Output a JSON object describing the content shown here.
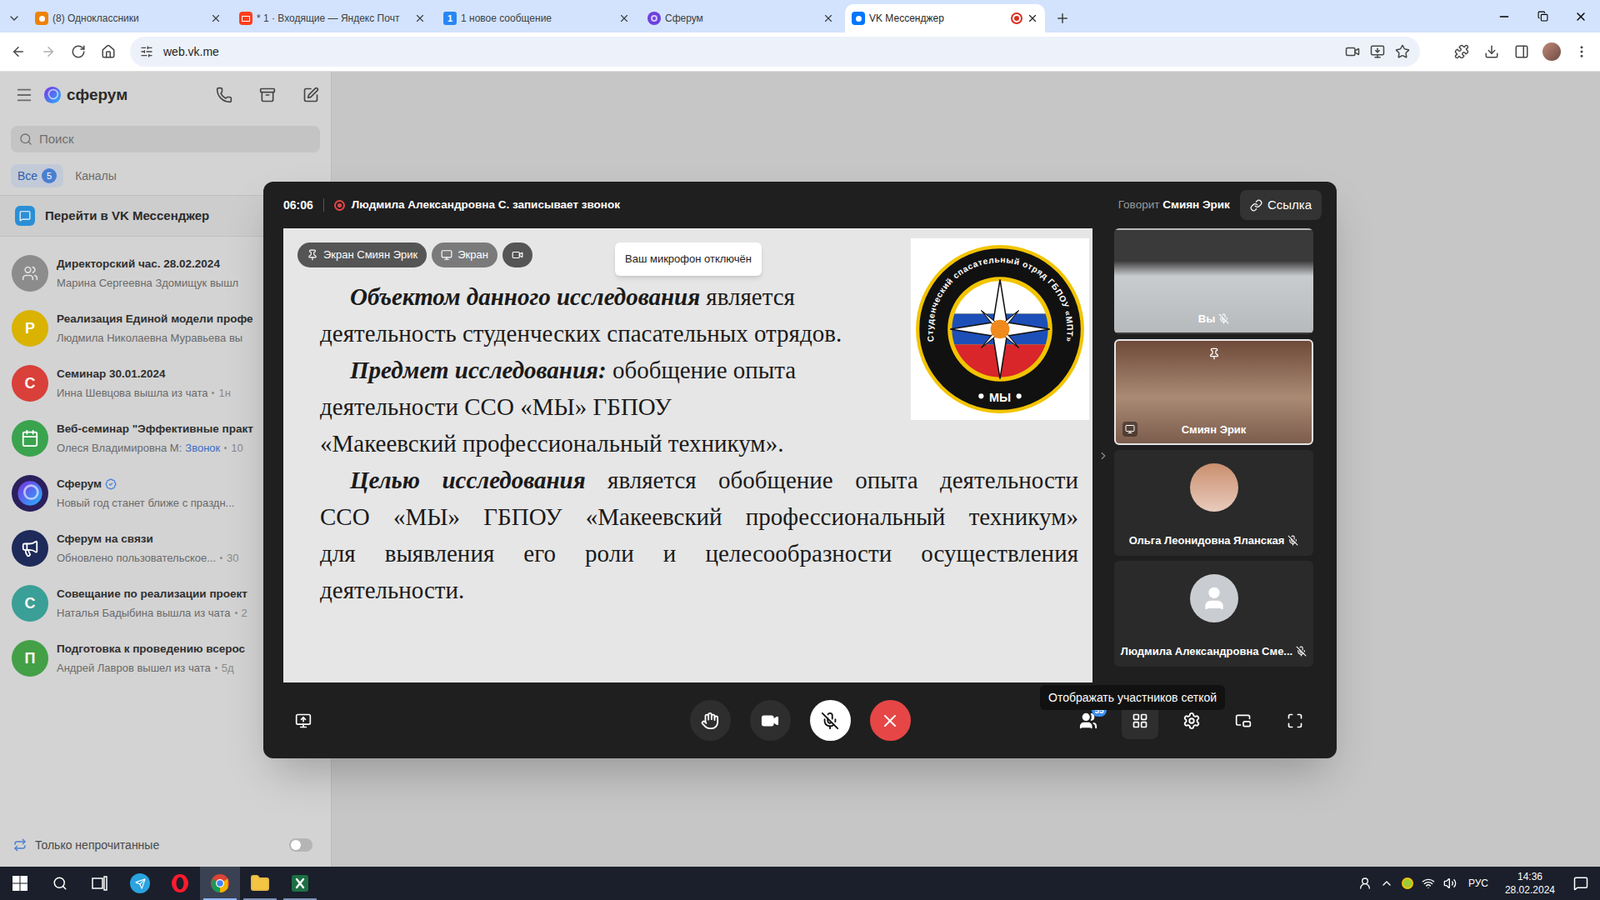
{
  "browser": {
    "tabs": [
      {
        "label": "(8) Одноклассники",
        "selected": false,
        "kind": "ok",
        "color": "#ee8208",
        "recording": false
      },
      {
        "label": "* 1 · Входящие — Яндекс Почт",
        "selected": false,
        "kind": "mail",
        "color": "#fc3f1d",
        "recording": false
      },
      {
        "label": "1 новое сообщение",
        "selected": false,
        "kind": "counter",
        "color": "#2787f5",
        "icon_text": "1",
        "recording": false
      },
      {
        "label": "Сферум",
        "selected": false,
        "kind": "sferum",
        "color": "#6d3fe0",
        "recording": false
      },
      {
        "label": "VK Мессенджер",
        "selected": true,
        "kind": "vk",
        "color": "#0077ff",
        "recording": true
      }
    ],
    "address": "web.vk.me"
  },
  "sidebar": {
    "logo": "сферум",
    "search_placeholder": "Поиск",
    "filters": [
      {
        "label": "Все",
        "count": "5",
        "selected": true
      },
      {
        "label": "Каналы",
        "selected": false
      }
    ],
    "vk_link": "Перейти в VK Мессенджер",
    "chats": [
      {
        "title": "Директорский час. 28.02.2024",
        "subtitle": "Марина Сергеевна Здомищук вышл",
        "avatar": "photo",
        "color": "#8c8c8c",
        "verified": false
      },
      {
        "title": "Реализация Единой модели профе",
        "subtitle": "Людмила Николаевна Муравьева вы",
        "avatar": "letter",
        "letter": "Р",
        "color": "#d9b300",
        "verified": false
      },
      {
        "title": "Семинар 30.01.2024",
        "subtitle": "Инна Шевцова вышла из чата",
        "time": "1н",
        "avatar": "letter",
        "letter": "С",
        "color": "#d9403a",
        "verified": false
      },
      {
        "title": "Веб-семинар \"Эффективные практ",
        "subtitle": "Олеся Владимировна М:",
        "highlight": "Звонок",
        "time": "10",
        "avatar": "calendar",
        "color": "#3aa34e",
        "verified": false
      },
      {
        "title": "Сферум",
        "subtitle": "Новый год станет ближе с праздн...",
        "avatar": "sferum",
        "color": "#2b1f5c",
        "verified": true
      },
      {
        "title": "Сферум на связи",
        "subtitle": "Обновлено пользовательское...",
        "time": "30",
        "avatar": "megaphone",
        "color": "#1e2a5a",
        "verified": false
      },
      {
        "title": "Совещание по реализации проект",
        "subtitle": "Наталья Бадыбина вышла из чата",
        "time": "2",
        "avatar": "letter",
        "letter": "С",
        "color": "#3a9f96",
        "verified": false
      },
      {
        "title": "Подготовка к проведению всерос",
        "subtitle": "Андрей Лавров вышел из чата",
        "time": "5д",
        "avatar": "letter",
        "letter": "П",
        "color": "#43a047",
        "verified": false
      }
    ],
    "unread_only": {
      "label": "Только непрочитанные",
      "on": false
    }
  },
  "call": {
    "timer": "06:06",
    "recording_text": "Людмила Александровна С. записывает звонок",
    "speaker_label": "Говорит",
    "speaker": "Смиян Эрик",
    "link_button": "Ссылка",
    "stage_badges": [
      {
        "label": "Экран Смиян Эрик",
        "kind": "pin",
        "selected": false
      },
      {
        "label": "Экран",
        "kind": "screen",
        "selected": true
      },
      {
        "kind": "camera",
        "selected": false
      }
    ],
    "mic_tooltip": "Ваш микрофон отключён",
    "slide": {
      "paragraphs": [
        {
          "beside_logo": true,
          "lines": [
            [
              {
                "text": "Объектом данного исследования",
                "emphasis": true
              },
              {
                "text": "является",
                "emphasis": false
              }
            ],
            [
              {
                "text": "деятельность студенческих спасательных отрядов.",
                "emphasis": false
              }
            ]
          ]
        },
        {
          "beside_logo": true,
          "lines": [
            [
              {
                "text": "Предмет исследования:",
                "emphasis": true
              },
              {
                "text": "обобщение опыта",
                "emphasis": false
              }
            ],
            [
              {
                "text": "деятельности ССО «МЫ» ГБПОУ",
                "emphasis": false
              }
            ],
            [
              {
                "text": "«Макеевский профессиональный техникум».",
                "emphasis": false
              }
            ]
          ]
        },
        {
          "beside_logo": false,
          "lines": [
            [
              {
                "text": "Целью исследования",
                "emphasis": true
              },
              {
                "text": "является обобщение опыта деятельности",
                "emphasis": false
              }
            ],
            [
              {
                "text": "ССО «МЫ» ГБПОУ «Макеевский профессиональный техникум»",
                "emphasis": false
              }
            ],
            [
              {
                "text": "для выявления его роли и целесообразности осуществления",
                "emphasis": false
              }
            ],
            [
              {
                "text": "деятельности.",
                "emphasis": false
              }
            ]
          ]
        }
      ],
      "logo": {
        "ring_text": "Студенческий спасательный отряд ГБПОУ «МПТ»",
        "label": "МЫ"
      }
    },
    "participants": [
      {
        "name": "Вы",
        "kind": "video",
        "muted": true,
        "pinned": false,
        "speaking": false,
        "sharing": false
      },
      {
        "name": "Смиян Эрик",
        "kind": "video",
        "muted": false,
        "pinned": true,
        "speaking": true,
        "sharing": true
      },
      {
        "name": "Ольга Леонидовна Яланская",
        "kind": "photo",
        "muted": true,
        "pinned": false,
        "speaking": false,
        "sharing": false
      },
      {
        "name": "Людмила Александровна Сме...",
        "kind": "placeholder",
        "muted": true,
        "pinned": false,
        "speaking": false,
        "sharing": false
      }
    ],
    "grid_tooltip": "Отображать участников сеткой",
    "participants_count": "55",
    "controls": {
      "hand_raised": false,
      "camera_on": true,
      "mic_muted": true
    }
  },
  "taskbar": {
    "apps": [
      {
        "kind": "telegram",
        "open": false,
        "active": false
      },
      {
        "kind": "opera",
        "open": false,
        "active": false
      },
      {
        "kind": "chrome",
        "open": true,
        "active": true
      },
      {
        "kind": "explorer",
        "open": true,
        "active": false
      },
      {
        "kind": "excel",
        "open": true,
        "active": false
      }
    ],
    "language": "РУС",
    "time": "14:36",
    "date": "28.02.2024"
  }
}
